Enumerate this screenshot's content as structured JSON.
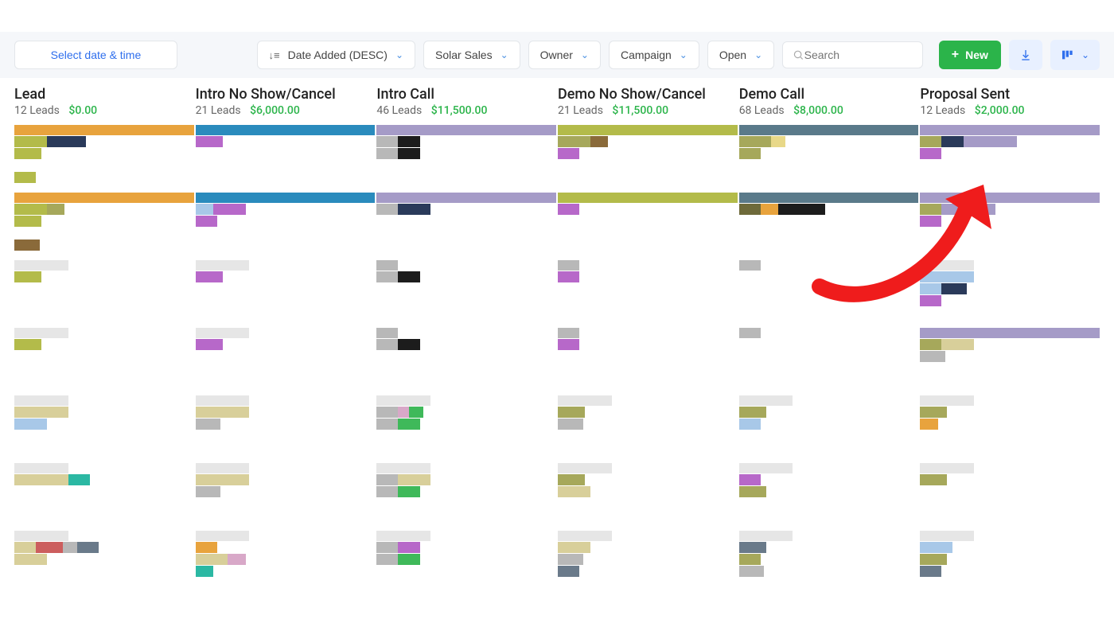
{
  "toolbar": {
    "date_label": "Select date & time",
    "sort_label": "Date Added (DESC)",
    "pipeline_label": "Solar Sales",
    "owner_label": "Owner",
    "campaign_label": "Campaign",
    "status_label": "Open",
    "search_placeholder": "Search",
    "new_label": "New"
  },
  "columns": [
    {
      "title": "Lead",
      "count": "12 Leads",
      "value": "$0.00"
    },
    {
      "title": "Intro No Show/Cancel",
      "count": "21 Leads",
      "value": "$6,000.00"
    },
    {
      "title": "Intro Call",
      "count": "46 Leads",
      "value": "$11,500.00"
    },
    {
      "title": "Demo No Show/Cancel",
      "count": "21 Leads",
      "value": "$11,500.00"
    },
    {
      "title": "Demo Call",
      "count": "68 Leads",
      "value": "$8,000.00"
    },
    {
      "title": "Proposal Sent",
      "count": "12 Leads",
      "value": "$2,000.00"
    }
  ],
  "palette": {
    "orange": "#e8a33d",
    "orange2": "#d68a2e",
    "blue": "#2a8bbd",
    "blue2": "#1f6fa0",
    "teal": "#2bb8a3",
    "purple": "#b768c9",
    "lilac": "#a59bc7",
    "olive": "#b3bb4a",
    "olive2": "#a6a85b",
    "dkolive": "#6e6a3a",
    "dark": "#1c1c1c",
    "grey": "#b8b8b8",
    "ltgrey": "#e6e6e6",
    "navy": "#2a3a5a",
    "green": "#3fb95a",
    "brown": "#8a6a3a",
    "slate": "#5a7a8a",
    "ltblue": "#a8c8e8",
    "pink": "#d8a8c8",
    "red": "#cc5e5e",
    "yellow": "#e8d888",
    "sand": "#d8cf9a",
    "mint": "#9ad8c8",
    "steel": "#6a7a8a"
  }
}
